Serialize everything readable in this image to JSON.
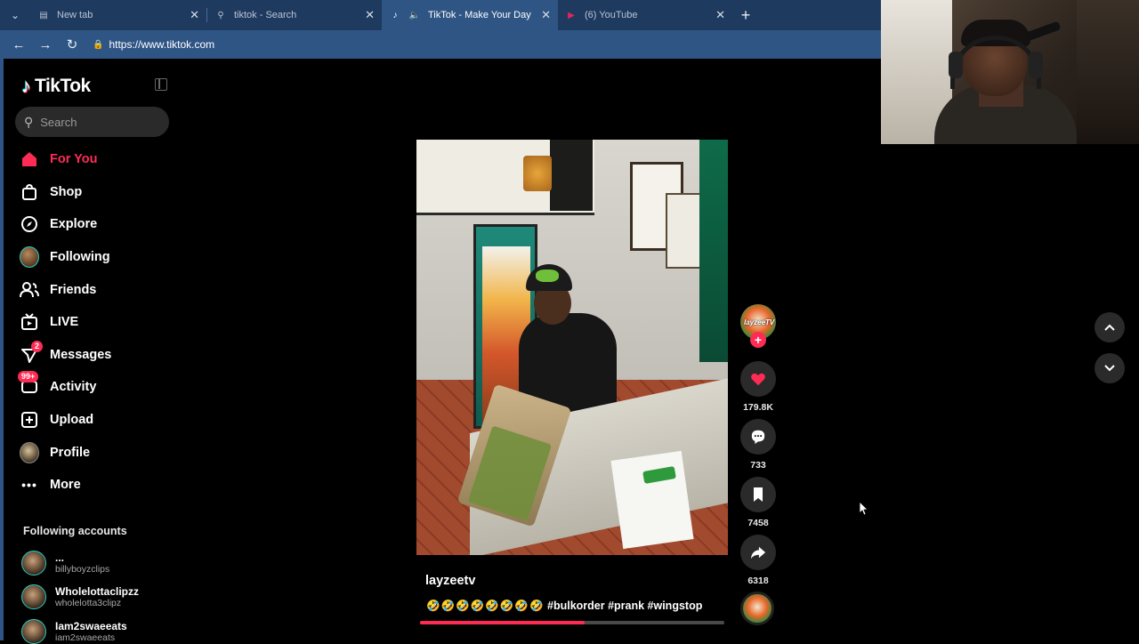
{
  "browser": {
    "tabs": [
      {
        "title": "New tab",
        "active": false,
        "icon": "new-tab-page-icon"
      },
      {
        "title": "tiktok - Search",
        "active": false,
        "icon": "search-icon"
      },
      {
        "title": "TikTok - Make Your Day",
        "active": true,
        "icon": "tiktok-icon"
      },
      {
        "title": "(6) YouTube",
        "active": false,
        "icon": "youtube-icon"
      }
    ],
    "url": "https://www.tiktok.com",
    "accent": "#2f5585"
  },
  "sidebar": {
    "brand": "TikTok",
    "search_placeholder": "Search",
    "nav": [
      {
        "label": "For You",
        "icon": "home-icon",
        "active": true
      },
      {
        "label": "Shop",
        "icon": "shopping-bag-icon"
      },
      {
        "label": "Explore",
        "icon": "compass-icon"
      },
      {
        "label": "Following",
        "icon": "following-avatar-icon"
      },
      {
        "label": "Friends",
        "icon": "friends-icon"
      },
      {
        "label": "LIVE",
        "icon": "live-tv-icon"
      },
      {
        "label": "Messages",
        "icon": "messages-icon",
        "badge": "2"
      },
      {
        "label": "Activity",
        "icon": "activity-icon",
        "badge": "99+"
      },
      {
        "label": "Upload",
        "icon": "upload-icon"
      },
      {
        "label": "Profile",
        "icon": "profile-avatar-icon"
      },
      {
        "label": "More",
        "icon": "more-icon"
      }
    ],
    "following_title": "Following accounts",
    "following_accounts": [
      {
        "name": "...",
        "handle": "billyboyzclips"
      },
      {
        "name": "Wholelottaclipzz",
        "handle": "wholelotta3clipz"
      },
      {
        "name": "Iam2swaeeats",
        "handle": "iam2swaeeats"
      }
    ]
  },
  "video": {
    "author": "layzeetv",
    "caption_emoji": "🤣🤣🤣🤣🤣🤣🤣🤣",
    "caption_tags": "#bulkorder #prank #wingstop",
    "avatar_tag": "layzeeTV",
    "progress": 0.54,
    "likes": "179.8K",
    "comments": "733",
    "saves": "7458",
    "shares": "6318",
    "like_color": "#fe2c55"
  }
}
